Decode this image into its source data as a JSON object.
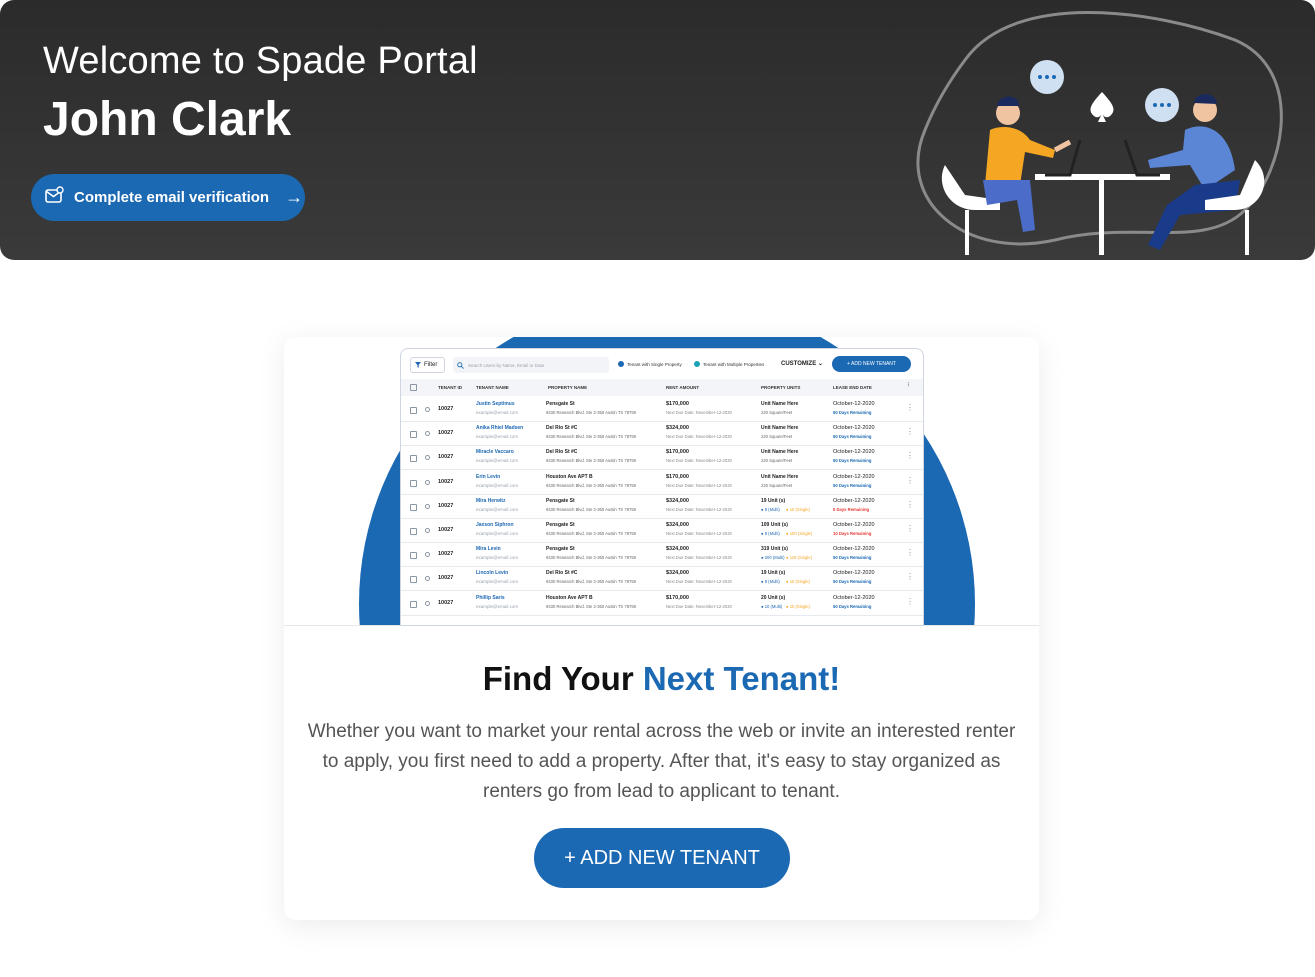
{
  "banner": {
    "welcome": "Welcome to Spade Portal",
    "user_name": "John Clark",
    "verify_label": "Complete email verification",
    "verify_arrow": "→"
  },
  "preview": {
    "filter_label": "Filter",
    "search_placeholder": "Search Users by Name, Email or Date",
    "legend_single": "Tenant with Single Property",
    "legend_multi": "Tenant with Multiple Properties",
    "customize_label": "CUSTOMIZE",
    "add_label": "+ ADD NEW TENANT",
    "columns": [
      "TENANT ID",
      "TENANT NAME",
      "PROPERTY NAME",
      "RENT AMOUNT",
      "PROPERTY UNITS",
      "LEASE END DATE"
    ],
    "rows": [
      {
        "id": "10027",
        "name": "Justin Septimus",
        "email": "example@email.com",
        "property": "Pensgate St",
        "address": "9430 Research Blvd. Ste 2-350 Austin TX 78759",
        "rent": "$170,000",
        "due": "Next Due Date: November-12-2020",
        "unit": "Unit Name Here",
        "unit_sub": "220 Square/Feet",
        "unit_sub2": "",
        "lease": "October-12-2020",
        "remaining": "50 Days Remaining",
        "remaining_color": "#1b68b3"
      },
      {
        "id": "10027",
        "name": "Anika Rhiel Madsen",
        "email": "example@email.com",
        "property": "Del Rio St #C",
        "address": "9430 Research Blvd. Ste 2-350 Austin TX 78759",
        "rent": "$324,000",
        "due": "Next Due Date: November-12-2020",
        "unit": "Unit Name Here",
        "unit_sub": "220 Square/Feet",
        "unit_sub2": "",
        "lease": "October-12-2020",
        "remaining": "50 Days Remaining",
        "remaining_color": "#1b68b3"
      },
      {
        "id": "10027",
        "name": "Miracle Vaccaro",
        "email": "example@email.com",
        "property": "Del Rio St #C",
        "address": "9430 Research Blvd. Ste 2-350 Austin TX 78759",
        "rent": "$170,000",
        "due": "Next Due Date: November-12-2020",
        "unit": "Unit Name Here",
        "unit_sub": "220 Square/Feet",
        "unit_sub2": "",
        "lease": "October-12-2020",
        "remaining": "50 Days Remaining",
        "remaining_color": "#1b68b3"
      },
      {
        "id": "10027",
        "name": "Erin Levin",
        "email": "example@email.com",
        "property": "Houston Ave APT B",
        "address": "9430 Research Blvd. Ste 2-350 Austin TX 78759",
        "rent": "$170,000",
        "due": "Next Due Date: November-12-2020",
        "unit": "Unit Name Here",
        "unit_sub": "220 Square/Feet",
        "unit_sub2": "",
        "lease": "October-12-2020",
        "remaining": "50 Days Remaining",
        "remaining_color": "#1b68b3"
      },
      {
        "id": "10027",
        "name": "Mira Herwitz",
        "email": "example@email.com",
        "property": "Pensgate St",
        "address": "9430 Research Blvd. Ste 2-350 Austin TX 78759",
        "rent": "$324,000",
        "due": "Next Due Date: November-12-2020",
        "unit": "19 Unit (s)",
        "unit_sub": "● 9 (Multi)",
        "unit_sub2": "● 10 (Single)",
        "lease": "October-12-2020",
        "remaining": "5 Days Remaining",
        "remaining_color": "#e53935"
      },
      {
        "id": "10027",
        "name": "Jaxson Siphron",
        "email": "example@email.com",
        "property": "Pensgate St",
        "address": "9430 Research Blvd. Ste 2-350 Austin TX 78759",
        "rent": "$324,000",
        "due": "Next Due Date: November-12-2020",
        "unit": "109 Unit (s)",
        "unit_sub": "● 9 (Multi)",
        "unit_sub2": "● 100 (Single)",
        "lease": "October-12-2020",
        "remaining": "10 Days Remaining",
        "remaining_color": "#e53935"
      },
      {
        "id": "10027",
        "name": "Mira Levin",
        "email": "example@email.com",
        "property": "Pensgate St",
        "address": "9430 Research Blvd. Ste 2-350 Austin TX 78759",
        "rent": "$324,000",
        "due": "Next Due Date: November-12-2020",
        "unit": "319 Unit (s)",
        "unit_sub": "● 200 (Multi)",
        "unit_sub2": "● 119 (Single)",
        "lease": "October-12-2020",
        "remaining": "50 Days Remaining",
        "remaining_color": "#1b68b3"
      },
      {
        "id": "10027",
        "name": "Lincoln Levin",
        "email": "example@email.com",
        "property": "Del Rio St #C",
        "address": "9430 Research Blvd. Ste 2-350 Austin TX 78759",
        "rent": "$324,000",
        "due": "Next Due Date: November-12-2020",
        "unit": "19 Unit (s)",
        "unit_sub": "● 9 (Multi)",
        "unit_sub2": "● 10 (Single)",
        "lease": "October-12-2020",
        "remaining": "50 Days Remaining",
        "remaining_color": "#1b68b3"
      },
      {
        "id": "10027",
        "name": "Phillip Saris",
        "email": "example@email.com",
        "property": "Houston Ave APT B",
        "address": "9430 Research Blvd. Ste 2-350 Austin TX 78759",
        "rent": "$170,000",
        "due": "Next Due Date: November-12-2020",
        "unit": "20 Unit (s)",
        "unit_sub": "● 10 (Multi)",
        "unit_sub2": "● 10 (Single)",
        "lease": "October-12-2020",
        "remaining": "50 Days Remaining",
        "remaining_color": "#1b68b3"
      }
    ]
  },
  "card": {
    "headline_plain": "Find Your ",
    "headline_accent": "Next Tenant!",
    "body": "Whether you want to market your rental across the web or invite an interested renter to apply, you first need to add a property. After that, it's easy to stay organized as renters go from lead to applicant to tenant.",
    "add_button": "+ ADD NEW TENANT"
  },
  "colors": {
    "brand_blue": "#1b68b3",
    "banner_dark": "#2b2b2b",
    "accent_teal": "#1aa3b8",
    "warn_red": "#e53935",
    "accent_orange": "#f5a623"
  },
  "icons": [
    "mail-check-icon",
    "arrow-right-icon",
    "filter-icon",
    "search-icon",
    "chevron-down-icon",
    "kebab-icon",
    "spade-icon",
    "chat-bubble-icon"
  ]
}
